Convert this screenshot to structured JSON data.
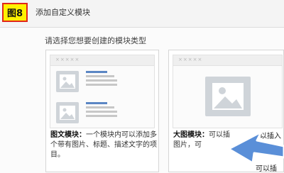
{
  "header": {
    "title": "添加自定义模块",
    "badge": "图8"
  },
  "prompt": "请选择您想要创建的模块类型",
  "card1": {
    "placeholder": "×××××",
    "title": "图文模块：",
    "text": "一个模块内可以添加多个带有图片、标题、描述文字的项目。"
  },
  "card2": {
    "placeholder": "×××××",
    "title": "大图模块：",
    "text_line1": "可以插",
    "text_line2": "图片，可",
    "partial_right1": "以插入",
    "partial_right2": "可以插"
  },
  "colors": {
    "badge_bg": "#fff100",
    "badge_border": "#e0261c",
    "arrow": "#5a8fd8"
  }
}
